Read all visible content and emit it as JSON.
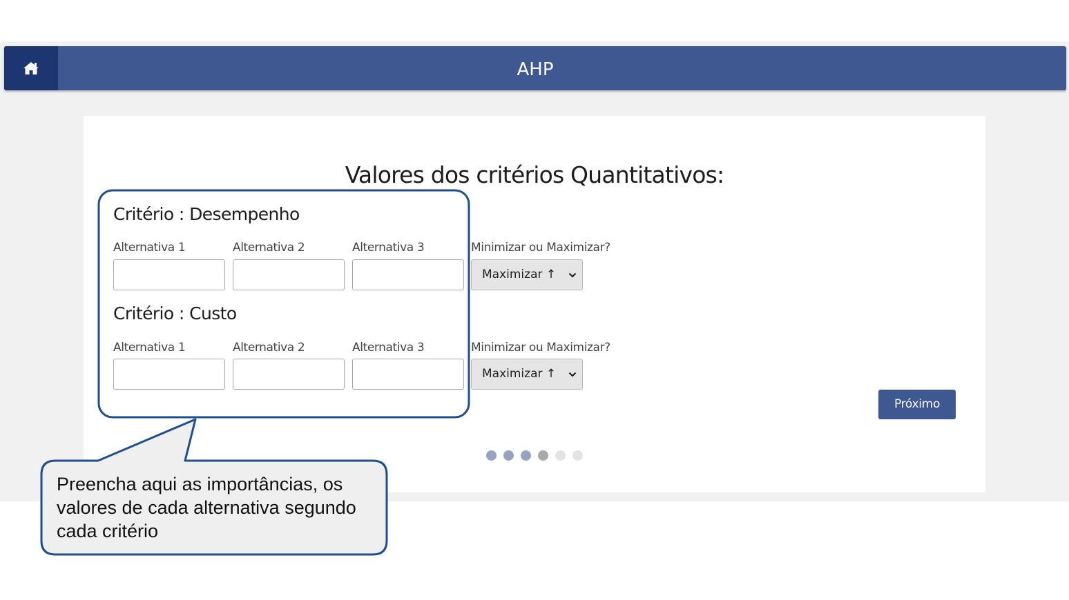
{
  "header": {
    "title": "AHP",
    "home_icon": "home-icon"
  },
  "page": {
    "title": "Valores dos critérios Quantitativos:"
  },
  "criteria": [
    {
      "title": "Critério : Desempenho",
      "alternatives": [
        "Alternativa 1",
        "Alternativa 2",
        "Alternativa 3"
      ],
      "values": [
        "",
        "",
        ""
      ],
      "direction_label": "Minimizar ou Maximizar?",
      "direction_value": "Maximizar ↑"
    },
    {
      "title": "Critério : Custo",
      "alternatives": [
        "Alternativa 1",
        "Alternativa 2",
        "Alternativa 3"
      ],
      "values": [
        "",
        "",
        ""
      ],
      "direction_label": "Minimizar ou Maximizar?",
      "direction_value": "Maximizar ↑"
    }
  ],
  "next_button": {
    "label": "Próximo"
  },
  "progress": {
    "steps": 6,
    "current": 4
  },
  "callout": {
    "text": "Preencha aqui as importâncias, os valores de cada alternativa segundo cada critério"
  },
  "colors": {
    "primary": "#3f5891",
    "home_bg": "#1d3570",
    "highlight": "#1f4e8c",
    "callout_bg": "#efefef"
  }
}
